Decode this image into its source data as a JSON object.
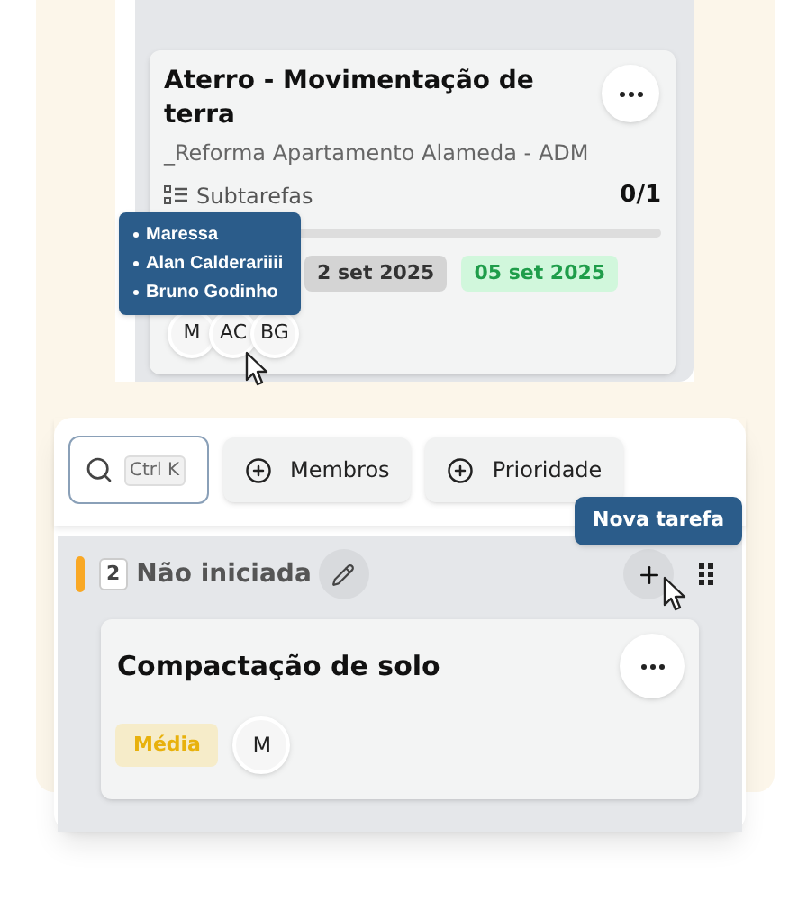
{
  "top_card": {
    "title": "Aterro - Movimentação de terra",
    "project": "_Reforma Apartamento Alameda - ADM",
    "subtasks_label": "Subtarefas",
    "subtasks_count": "0/1",
    "level": 0,
    "dates": [
      {
        "text": "2 set 2025",
        "kind": "start"
      },
      {
        "text": "05 set 2025",
        "kind": "due"
      }
    ],
    "avatars": [
      "M",
      "AC",
      "BG"
    ]
  },
  "members_tooltip": [
    "Maressa",
    "Alan Calderariiii",
    "Bruno Godinho"
  ],
  "toolbar": {
    "shortcut": "Ctrl K",
    "buttons": [
      "Membros",
      "Prioridade"
    ]
  },
  "new_task_tooltip": "Nova tarefa",
  "column": {
    "count": "2",
    "title": "Não iniciada"
  },
  "task": {
    "title": "Compactação de solo",
    "priority": "Média",
    "avatars": [
      "M"
    ]
  }
}
